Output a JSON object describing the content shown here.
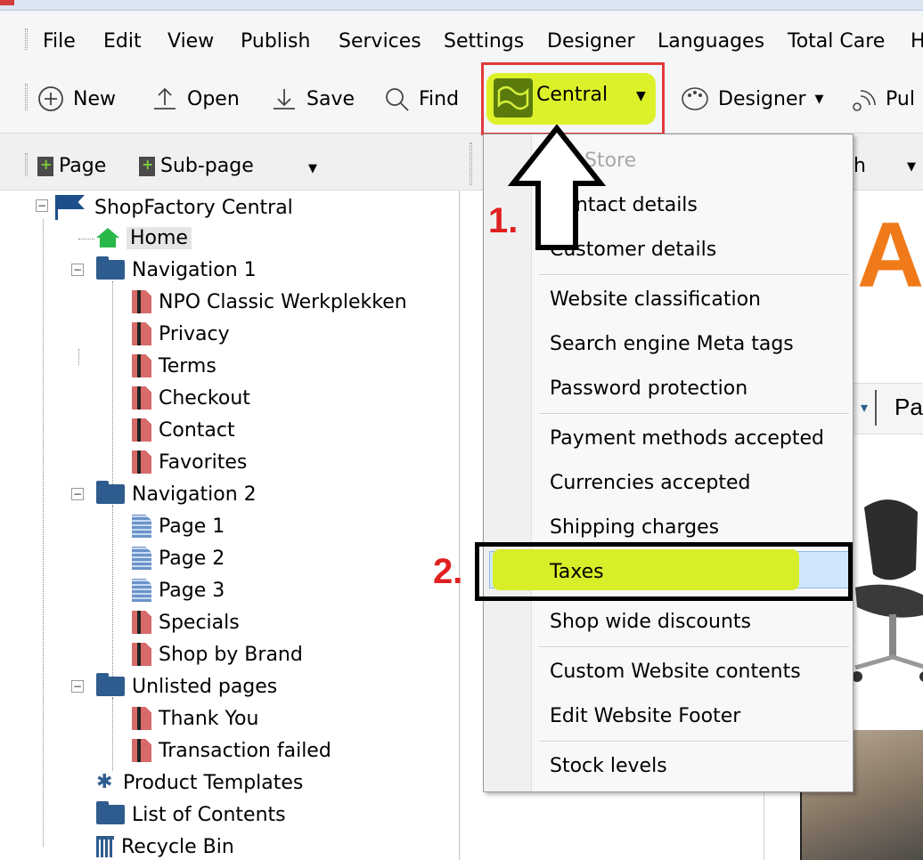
{
  "menu": {
    "items": [
      "File",
      "Edit",
      "View",
      "Publish",
      "Services",
      "Settings",
      "Designer",
      "Languages",
      "Total Care",
      "H"
    ]
  },
  "toolbar": {
    "new_label": "New",
    "open_label": "Open",
    "save_label": "Save",
    "find_label": "Find",
    "central_label": "Central",
    "designer_label": "Designer",
    "publish_label": "Pul"
  },
  "left_toolbar": {
    "page_label": "Page",
    "subpage_label": "Sub-page"
  },
  "tree": {
    "root": "ShopFactory Central",
    "home": "Home",
    "nav1": "Navigation 1",
    "nav1_items": [
      "NPO Classic Werkplekken",
      "Privacy",
      "Terms",
      "Checkout",
      "Contact",
      "Favorites"
    ],
    "nav2": "Navigation 2",
    "nav2_items": [
      "Page 1",
      "Page 2",
      "Page 3",
      "Specials",
      "Shop by Brand"
    ],
    "unlisted": "Unlisted pages",
    "unlisted_items": [
      "Thank You",
      "Transaction failed"
    ],
    "product_templates": "Product Templates",
    "list_of_contents": "List of Contents",
    "recycle_bin": "Recycle Bin"
  },
  "dropdown": {
    "my_store": "My Store",
    "contact_details": "Contact details",
    "customer_details": "Customer details",
    "website_classification": "Website classification",
    "search_meta": "Search engine Meta tags",
    "password_protection": "Password protection",
    "payment_methods": "Payment methods accepted",
    "currencies": "Currencies accepted",
    "shipping": "Shipping charges",
    "taxes": "Taxes",
    "discounts": "Shop wide discounts",
    "custom_contents": "Custom Website contents",
    "edit_footer": "Edit Website Footer",
    "stock_levels": "Stock levels"
  },
  "right_panel": {
    "toolbar_fragment": "h",
    "brand_fragment": "Ar",
    "nav_fragment": "Pa"
  },
  "annotations": {
    "step1": "1.",
    "step2": "2."
  },
  "colors": {
    "highlight_yellow": "#ddf12a",
    "annotation_red": "#e02020",
    "brand_orange": "#f07a1a",
    "folder_blue": "#2f5c8e",
    "selection_blue": "#cfe6fc"
  }
}
